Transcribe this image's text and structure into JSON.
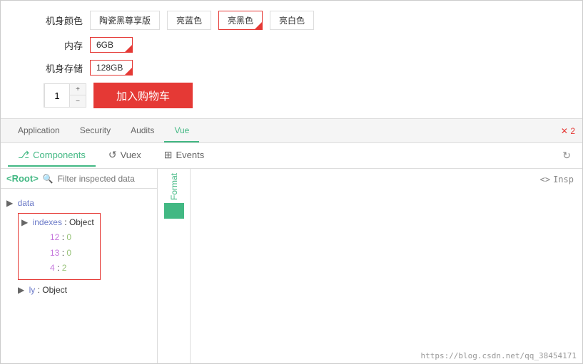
{
  "product": {
    "color_label": "机身颜色",
    "color_options": [
      "陶瓷黑尊享版",
      "亮蓝色",
      "亮黑色",
      "亮白色"
    ],
    "selected_color_index": 2,
    "memory_label": "内存",
    "memory_value": "6GB",
    "storage_label": "机身存储",
    "storage_value": "128GB",
    "quantity": "1",
    "add_to_cart": "加入购物车"
  },
  "devtools": {
    "tabs": [
      "Application",
      "Security",
      "Audits",
      "Vue"
    ],
    "active_tab": "Vue",
    "badge": "2",
    "sub_tabs": [
      "Components",
      "Vuex",
      "Events"
    ],
    "active_sub_tab": "Components",
    "components_icon": "⎇",
    "vuex_icon": "↺",
    "events_icon": "⊞",
    "refresh_icon": "↻",
    "root_tag": "<Root>",
    "filter_placeholder": "Filter inspected data",
    "format_label": "Format",
    "inspect_label": "<> Insp",
    "data_tree": {
      "data_key": "data",
      "indexes_key": "indexes",
      "indexes_value": "Object",
      "children": [
        {
          "key": "12",
          "value": "0"
        },
        {
          "key": "13",
          "value": "0"
        },
        {
          "key": "4",
          "value": "2"
        }
      ],
      "ly_key": "ly",
      "ly_value": "Object"
    },
    "url": "https://blog.csdn.net/qq_38454171"
  }
}
